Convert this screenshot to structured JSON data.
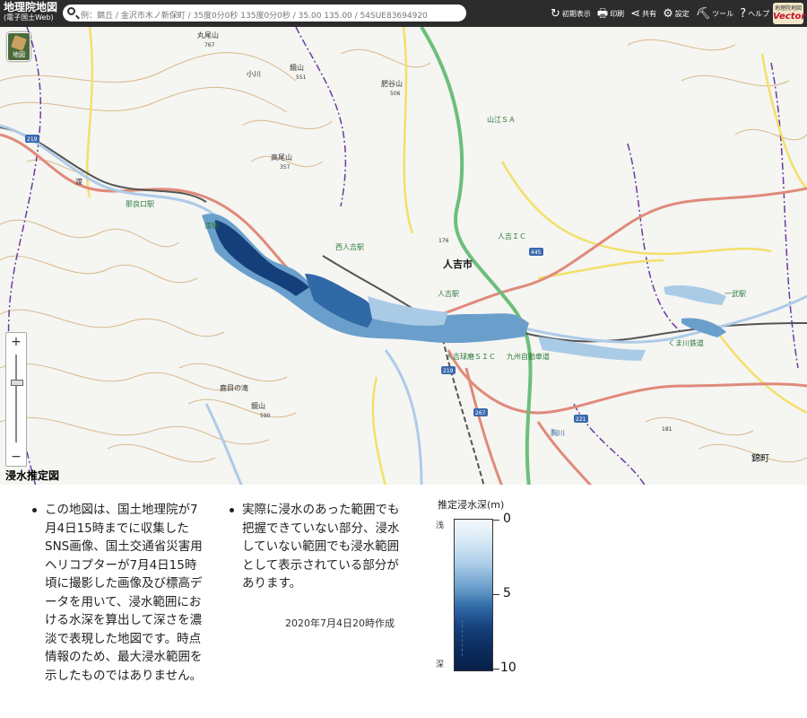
{
  "app": {
    "title": "地理院地図",
    "subtitle": "(電子国土Web)",
    "vector_top": "地理院地図",
    "vector_bottom": "Vector"
  },
  "search": {
    "placeholder": "例：錦丘 / 金沢市木ノ新保町 / 35度0分0秒 135度0分0秒 / 35.00 135.00 / 54SUE83694920"
  },
  "toolbar": [
    {
      "icon": "reset-icon",
      "glyph": "↻",
      "label": "初期表示"
    },
    {
      "icon": "print-icon",
      "glyph": "🖶",
      "label": "印刷"
    },
    {
      "icon": "share-icon",
      "glyph": "⋖",
      "label": "共有"
    },
    {
      "icon": "gear-icon",
      "glyph": "⚙",
      "label": "設定"
    },
    {
      "icon": "tool-icon",
      "glyph": "⛏",
      "label": "ツール"
    },
    {
      "icon": "help-icon",
      "glyph": "?",
      "label": "ヘルプ"
    }
  ],
  "map": {
    "layer_button_label": "地図",
    "zoom_in": "+",
    "zoom_out": "−",
    "labels": {
      "maruoyama": "丸尾山",
      "maruoyama_elev": "767",
      "kaneyama": "鏡山",
      "kaneyama_elev": "551",
      "oyama_kawa": "小川",
      "shiyama": "肥谷山",
      "shiyama_elev": "506",
      "sanko_sa": "山江ＳＡ",
      "takaoyama": "高尾山",
      "takaoyama_elev": "357",
      "watari_eki": "渡駅",
      "nabeguchi_eki": "那良口駅",
      "watari": "渡",
      "nishi_hitoyoshi": "西人吉駅",
      "hitoyoshi_city": "人吉市",
      "hitoyoshi_ic": "人吉ＩＣ",
      "hitoyoshi_eki": "人吉駅",
      "hitoyoshi_kyuma_sic": "人吉球磨ＳＩＣ",
      "kyushu_expressway": "九州自動車道",
      "kuma_railway": "くま川鉄道",
      "ichibu_eki": "一武駅",
      "nishiki_machi": "錦町",
      "kumagawa": "球磨川",
      "kagamiyama": "鏡山",
      "kagamiyama_elev": "590",
      "sakamoto_taki": "鹿目の滝",
      "rd_219": "219",
      "rd_445": "445",
      "rd_267": "267",
      "rd_221": "221",
      "rd_219b": "219",
      "pt_176": "176",
      "pt_181": "181",
      "komagawa": "胸川",
      "kumakawa": "球磨川"
    }
  },
  "panel": {
    "title": "浸水推定図",
    "bullet1_lines": [
      "この地図は、国土地理院が7",
      "月4日15時までに収集した",
      "SNS画像、国土交通省災害用",
      "ヘリコプターが7月4日15時",
      "頃に撮影した画像及び標高デ",
      "ータを用いて、浸水範囲にお",
      "ける水深を算出して深さを濃",
      "淡で表現した地図です。時点",
      "情報のため、最大浸水範囲を",
      "示したものではありません。"
    ],
    "bullet2_lines": [
      "実際に浸水のあった範囲でも",
      "把握できていない部分、浸水",
      "していない範囲でも浸水範囲",
      "として表示されている部分が",
      "あります。"
    ],
    "date": "2020年7月4日20時作成"
  },
  "legend": {
    "title": "推定浸水深(m)",
    "tick_0": "0",
    "tick_5": "5",
    "tick_10": "10",
    "end_top": "浅",
    "end_bottom": "深",
    "colors": [
      "#f4f9fd",
      "#a9cbe6",
      "#2f6aa6",
      "#081f48"
    ]
  }
}
